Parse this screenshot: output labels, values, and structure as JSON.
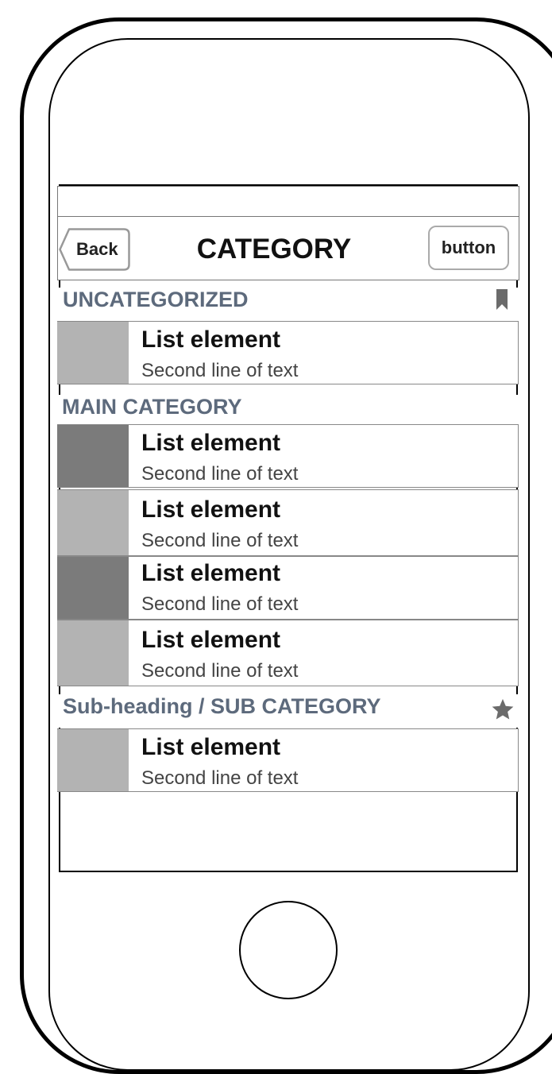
{
  "nav": {
    "back_label": "Back",
    "title": "CATEGORY",
    "right_button_label": "button"
  },
  "sections": [
    {
      "heading": "UNCATEGORIZED",
      "icon": "bookmark-icon"
    },
    {
      "heading": "MAIN CATEGORY",
      "icon": ""
    },
    {
      "heading": "Sub-heading / SUB CATEGORY",
      "icon": "star-icon"
    }
  ],
  "items": [
    {
      "title": "List element",
      "subtitle": "Second line of text",
      "thumb": "light"
    },
    {
      "title": "List element",
      "subtitle": "Second line of text",
      "thumb": "dark"
    },
    {
      "title": "List element",
      "subtitle": "Second line of text",
      "thumb": "light"
    },
    {
      "title": "List element",
      "subtitle": "Second line of text",
      "thumb": "dark"
    },
    {
      "title": "List element",
      "subtitle": "Second line of text",
      "thumb": "light"
    },
    {
      "title": "List element",
      "subtitle": "Second line of text",
      "thumb": "light"
    }
  ],
  "colors": {
    "section_heading": "#5d6a7c",
    "thumb_light": "#b3b3b3",
    "thumb_dark": "#7b7b7b",
    "icon": "#6b6b6b"
  }
}
